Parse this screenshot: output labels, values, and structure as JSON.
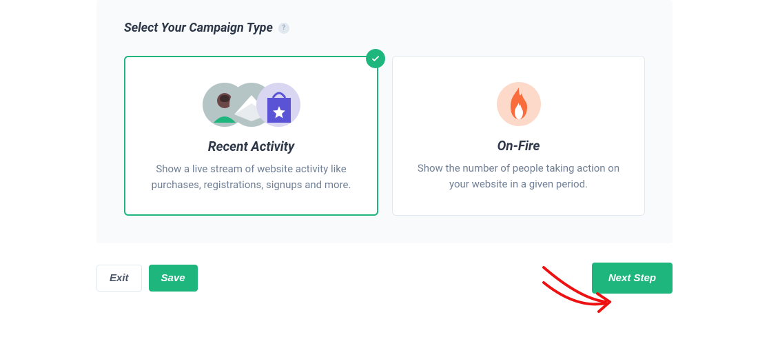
{
  "heading": "Select Your Campaign Type",
  "cards": [
    {
      "title": "Recent Activity",
      "description": "Show a live stream of website activity like purchases, registrations, signups and more.",
      "selected": true
    },
    {
      "title": "On-Fire",
      "description": "Show the number of people taking action on your website in a given period.",
      "selected": false
    }
  ],
  "buttons": {
    "exit": "Exit",
    "save": "Save",
    "next": "Next Step"
  },
  "colors": {
    "primary": "#1fb67e",
    "fire": "#f96c3b"
  }
}
